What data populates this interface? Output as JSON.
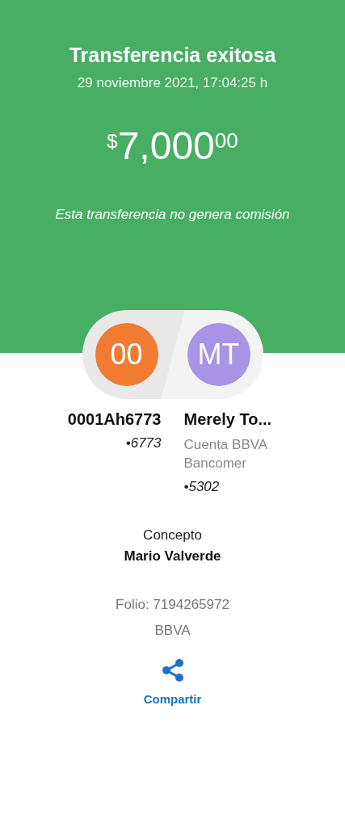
{
  "header": {
    "title": "Transferencia exitosa",
    "datetime": "29 noviembre 2021, 17:04:25 h",
    "amount": {
      "currency": "$",
      "value": "7,000",
      "cents": "00"
    },
    "note": "Esta transferencia no genera comisión"
  },
  "parties": [
    {
      "initials": "00",
      "color": "#f07c32",
      "name": "0001Ah6773",
      "account": "•6773"
    },
    {
      "initials": "MT",
      "color": "#a893e4",
      "name": "Merely To...",
      "bank": "Cuenta BBVA Bancomer",
      "account": "•5302"
    }
  ],
  "concept": {
    "label": "Concepto",
    "value": "Mario Valverde"
  },
  "folio": "Folio: 7194265972",
  "bank": "BBVA",
  "share": {
    "label": "Compartir"
  }
}
